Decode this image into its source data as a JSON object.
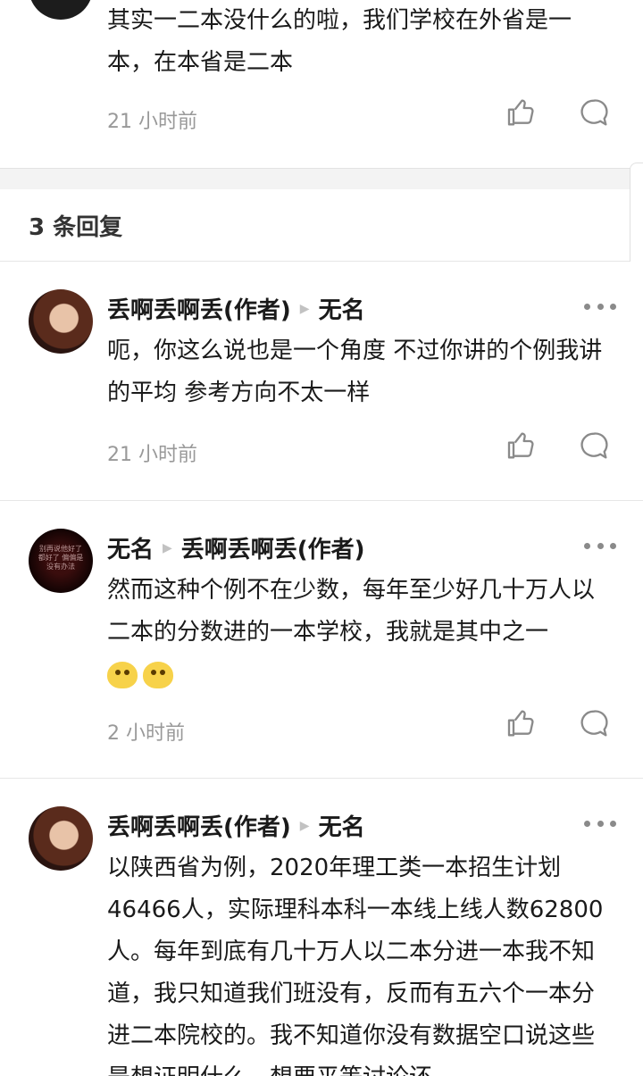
{
  "top_comment": {
    "text": "其实一二本没什么的啦，我们学校在外省是一本，在本省是二本",
    "time": "21 小时前"
  },
  "replies_header": "3 条回复",
  "replies": [
    {
      "author": "丢啊丢啊丢(作者)",
      "reply_to": "无名",
      "text": "呃，你这么说也是一个角度 不过你讲的个例我讲的平均 参考方向不太一样",
      "time": "21 小时前"
    },
    {
      "author": "无名",
      "reply_to": "丢啊丢啊丢(作者)",
      "avatar_text": "别再说他好了 都好了 偏偏是 没有办法",
      "text": "然而这种个例不在少数，每年至少好几十万人以二本的分数进的一本学校，我就是其中之一",
      "time": "2 小时前"
    },
    {
      "author": "丢啊丢啊丢(作者)",
      "reply_to": "无名",
      "text": "以陕西省为例，2020年理工类一本招生计划46466人，实际理科本科一本线上线人数62800人。每年到底有几十万人以二本分进一本我不知道，我只知道我们班没有，反而有五六个一本分进二本院校的。我不知道你没有数据空口说这些是想证明什么，想要平等讨论还"
    }
  ],
  "icons": {
    "like": "thumbs-up-icon",
    "reply": "comment-bubble-icon",
    "more": "more-dots-icon",
    "emoji": "doge-emoji-icon"
  },
  "colors": {
    "text": "#1a1a1a",
    "time": "#999999",
    "icon": "#8a8a8a",
    "divider": "#f3f3f3"
  }
}
